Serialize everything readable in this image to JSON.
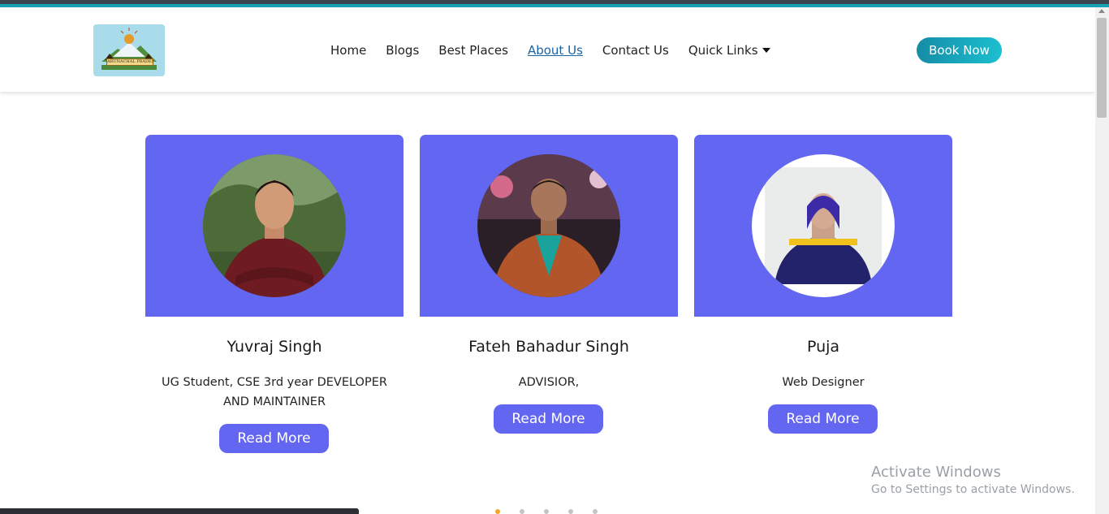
{
  "header": {
    "logo_text": "ARUNACHAL PRADESH",
    "nav": [
      "Home",
      "Blogs",
      "Best Places",
      "About Us",
      "Contact Us",
      "Quick Links"
    ],
    "active_nav": "About Us",
    "book_now": "Book Now"
  },
  "team": [
    {
      "name": "Yuvraj Singh",
      "role": "UG Student, CSE 3rd year DEVELOPER AND MAINTAINER",
      "button": "Read More"
    },
    {
      "name": "Fateh Bahadur Singh",
      "role": "ADVISIOR,",
      "button": "Read More"
    },
    {
      "name": "Puja",
      "role": "Web Designer",
      "button": "Read More"
    }
  ],
  "carousel": {
    "dots": 5,
    "active_index": 0
  },
  "watermark": {
    "title": "Activate Windows",
    "subtitle": "Go to Settings to activate Windows."
  },
  "colors": {
    "card_accent": "#6366f1",
    "book_gradient_start": "#158da6",
    "book_gradient_end": "#1cbfd0",
    "active_link": "#1a63a5",
    "active_dot": "#f5a623"
  },
  "icons": [
    "quick-links-caret-icon"
  ]
}
